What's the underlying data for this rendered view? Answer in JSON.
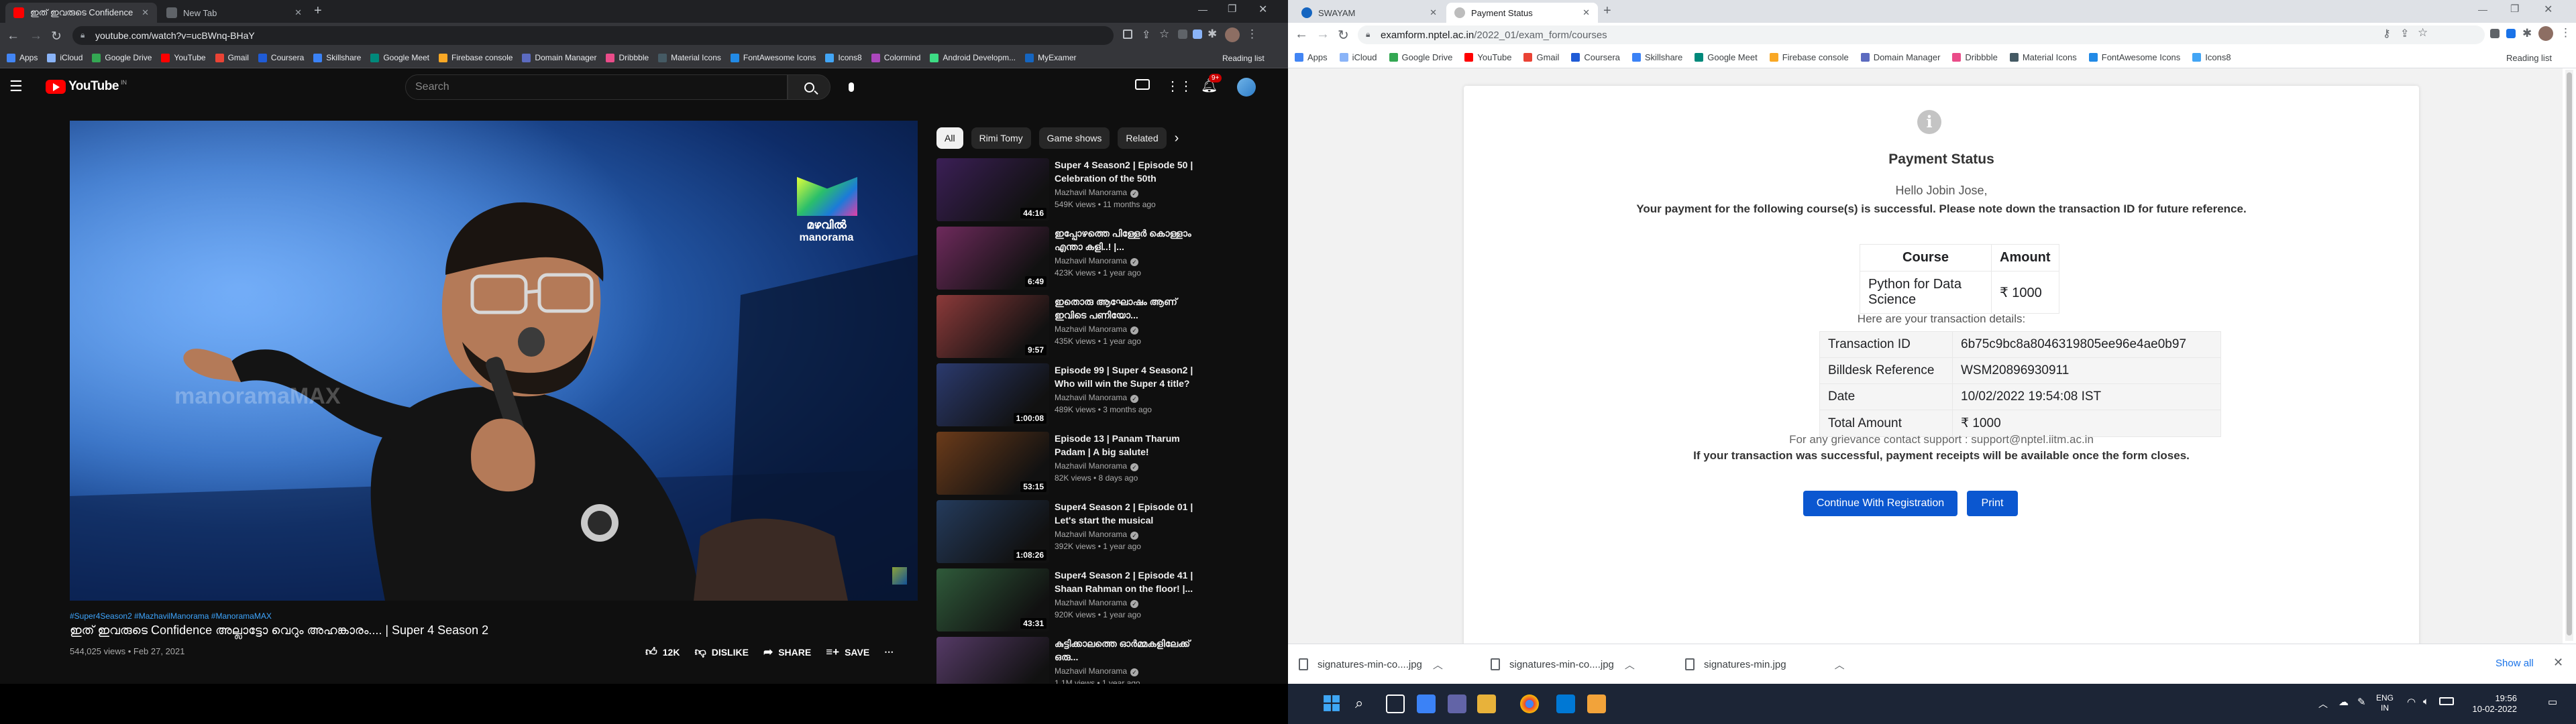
{
  "left_browser": {
    "tabs": [
      {
        "title": "ഇത് ഇവരുടെ Confidence",
        "active": true
      },
      {
        "title": "New Tab",
        "active": false
      }
    ],
    "url": "youtube.com/watch?v=ucBWnq-BHaY",
    "bookmarks": [
      "Apps",
      "iCloud",
      "Google Drive",
      "YouTube",
      "Gmail",
      "Coursera",
      "Skillshare",
      "Google Meet",
      "Firebase console",
      "Domain Manager",
      "Dribbble",
      "Material Icons",
      "FontAwesome Icons",
      "Icons8",
      "Colormind",
      "Android Developm...",
      "MyExamer"
    ],
    "reading_list": "Reading list"
  },
  "youtube": {
    "logo": "YouTube",
    "country": "IN",
    "search_placeholder": "Search",
    "notification_count": "9+",
    "video": {
      "watermark_top": "മഴവിൽ",
      "watermark_bottom": "manorama",
      "faded_logo": "manoramaMAX",
      "hashtags": "#Super4Season2 #MazhavilManorama #ManoramaMAX",
      "title": "ഇത് ഇവരുടെ Confidence അല്ലാട്ടോ വെറും അഹങ്കാരം.... | Super 4 Season 2",
      "meta": "544,025 views • Feb 27, 2021",
      "likes": "12K",
      "dislike": "DISLIKE",
      "share": "SHARE",
      "save": "SAVE"
    },
    "chips": [
      "All",
      "Rimi Tomy",
      "Game shows",
      "Related"
    ],
    "recommendations": [
      {
        "title": "Super 4 Season2 | Episode 50 | Celebration of the 50th episod...",
        "channel": "Mazhavil Manorama",
        "meta": "549K views • 11 months ago",
        "duration": "44:16",
        "color": "#3b1f56"
      },
      {
        "title": "ഇപ്പോഴത്തെ പിള്ളേർ കൊള്ളാം എന്താ കളി..! |...",
        "channel": "Mazhavil Manorama",
        "meta": "423K views • 1 year ago",
        "duration": "6:49",
        "color": "#6e2a5c"
      },
      {
        "title": "ഇതൊരു ആഘോഷം ആണ് ഇവിടെ പണിയോ...",
        "channel": "Mazhavil Manorama",
        "meta": "435K views • 1 year ago",
        "duration": "9:57",
        "color": "#8c3a3a"
      },
      {
        "title": "Episode 99 | Super 4 Season2 | Who will win the Super 4 title?",
        "channel": "Mazhavil Manorama",
        "meta": "489K views • 3 months ago",
        "duration": "1:00:08",
        "color": "#2b3a6e"
      },
      {
        "title": "Episode 13 | Panam Tharum Padam | A big salute!",
        "channel": "Mazhavil Manorama",
        "meta": "82K views • 8 days ago",
        "duration": "53:15",
        "color": "#6b3b1a"
      },
      {
        "title": "Super4 Season 2 | Episode 01 | Let's start the musical journey...",
        "channel": "Mazhavil Manorama",
        "meta": "392K views • 1 year ago",
        "duration": "1:08:26",
        "color": "#243b5c"
      },
      {
        "title": "Super4 Season 2 | Episode 41 | Shaan Rahman on the floor! |...",
        "channel": "Mazhavil Manorama",
        "meta": "920K views • 1 year ago",
        "duration": "43:31",
        "color": "#2f5a3a"
      },
      {
        "title": "കുട്ടിക്കാലത്തെ ഓർമ്മകളിലേക്ക് ഒരു...",
        "channel": "Mazhavil Manorama",
        "meta": "1.1M views • 1 year ago",
        "duration": "",
        "color": "#553a66"
      }
    ]
  },
  "right_browser": {
    "tabs": [
      {
        "title": "SWAYAM",
        "active": false
      },
      {
        "title": "Payment Status",
        "active": true
      }
    ],
    "url_host": "examform.nptel.ac.in",
    "url_path": "/2022_01/exam_form/courses",
    "bookmarks": [
      "Apps",
      "iCloud",
      "Google Drive",
      "YouTube",
      "Gmail",
      "Coursera",
      "Skillshare",
      "Google Meet",
      "Firebase console",
      "Domain Manager",
      "Dribbble",
      "Material Icons",
      "FontAwesome Icons",
      "Icons8"
    ],
    "reading_list": "Reading list"
  },
  "payment": {
    "heading": "Payment Status",
    "greeting": "Hello Jobin Jose,",
    "message": "Your payment for the following course(s) is successful. Please note down the transaction ID for future reference.",
    "course_table": {
      "headers": [
        "Course",
        "Amount"
      ],
      "rows": [
        [
          "Python for Data Science",
          "₹ 1000"
        ]
      ]
    },
    "details_label": "Here are your transaction details:",
    "details": [
      [
        "Transaction ID",
        "6b75c9bc8a8046319805ee96e4ae0b97"
      ],
      [
        "Billdesk Reference",
        "WSM20896930911"
      ],
      [
        "Date",
        "10/02/2022 19:54:08 IST"
      ],
      [
        "Total Amount",
        "₹ 1000"
      ]
    ],
    "grievance": "For any grievance contact support : support@nptel.iitm.ac.in",
    "receipt_note": "If your transaction was successful, payment receipts will be available once the form closes.",
    "continue_button": "Continue With Registration",
    "print_button": "Print"
  },
  "downloads": {
    "items": [
      "signatures-min-co....jpg",
      "signatures-min-co....jpg",
      "signatures-min.jpg"
    ],
    "show_all": "Show all"
  },
  "taskbar": {
    "lang": "ENG",
    "region": "IN",
    "time": "19:56",
    "date": "10-02-2022"
  },
  "colors": {
    "yt_red": "#ff0000",
    "accent_blue": "#0b57d0",
    "chrome_dark": "#35363a"
  }
}
